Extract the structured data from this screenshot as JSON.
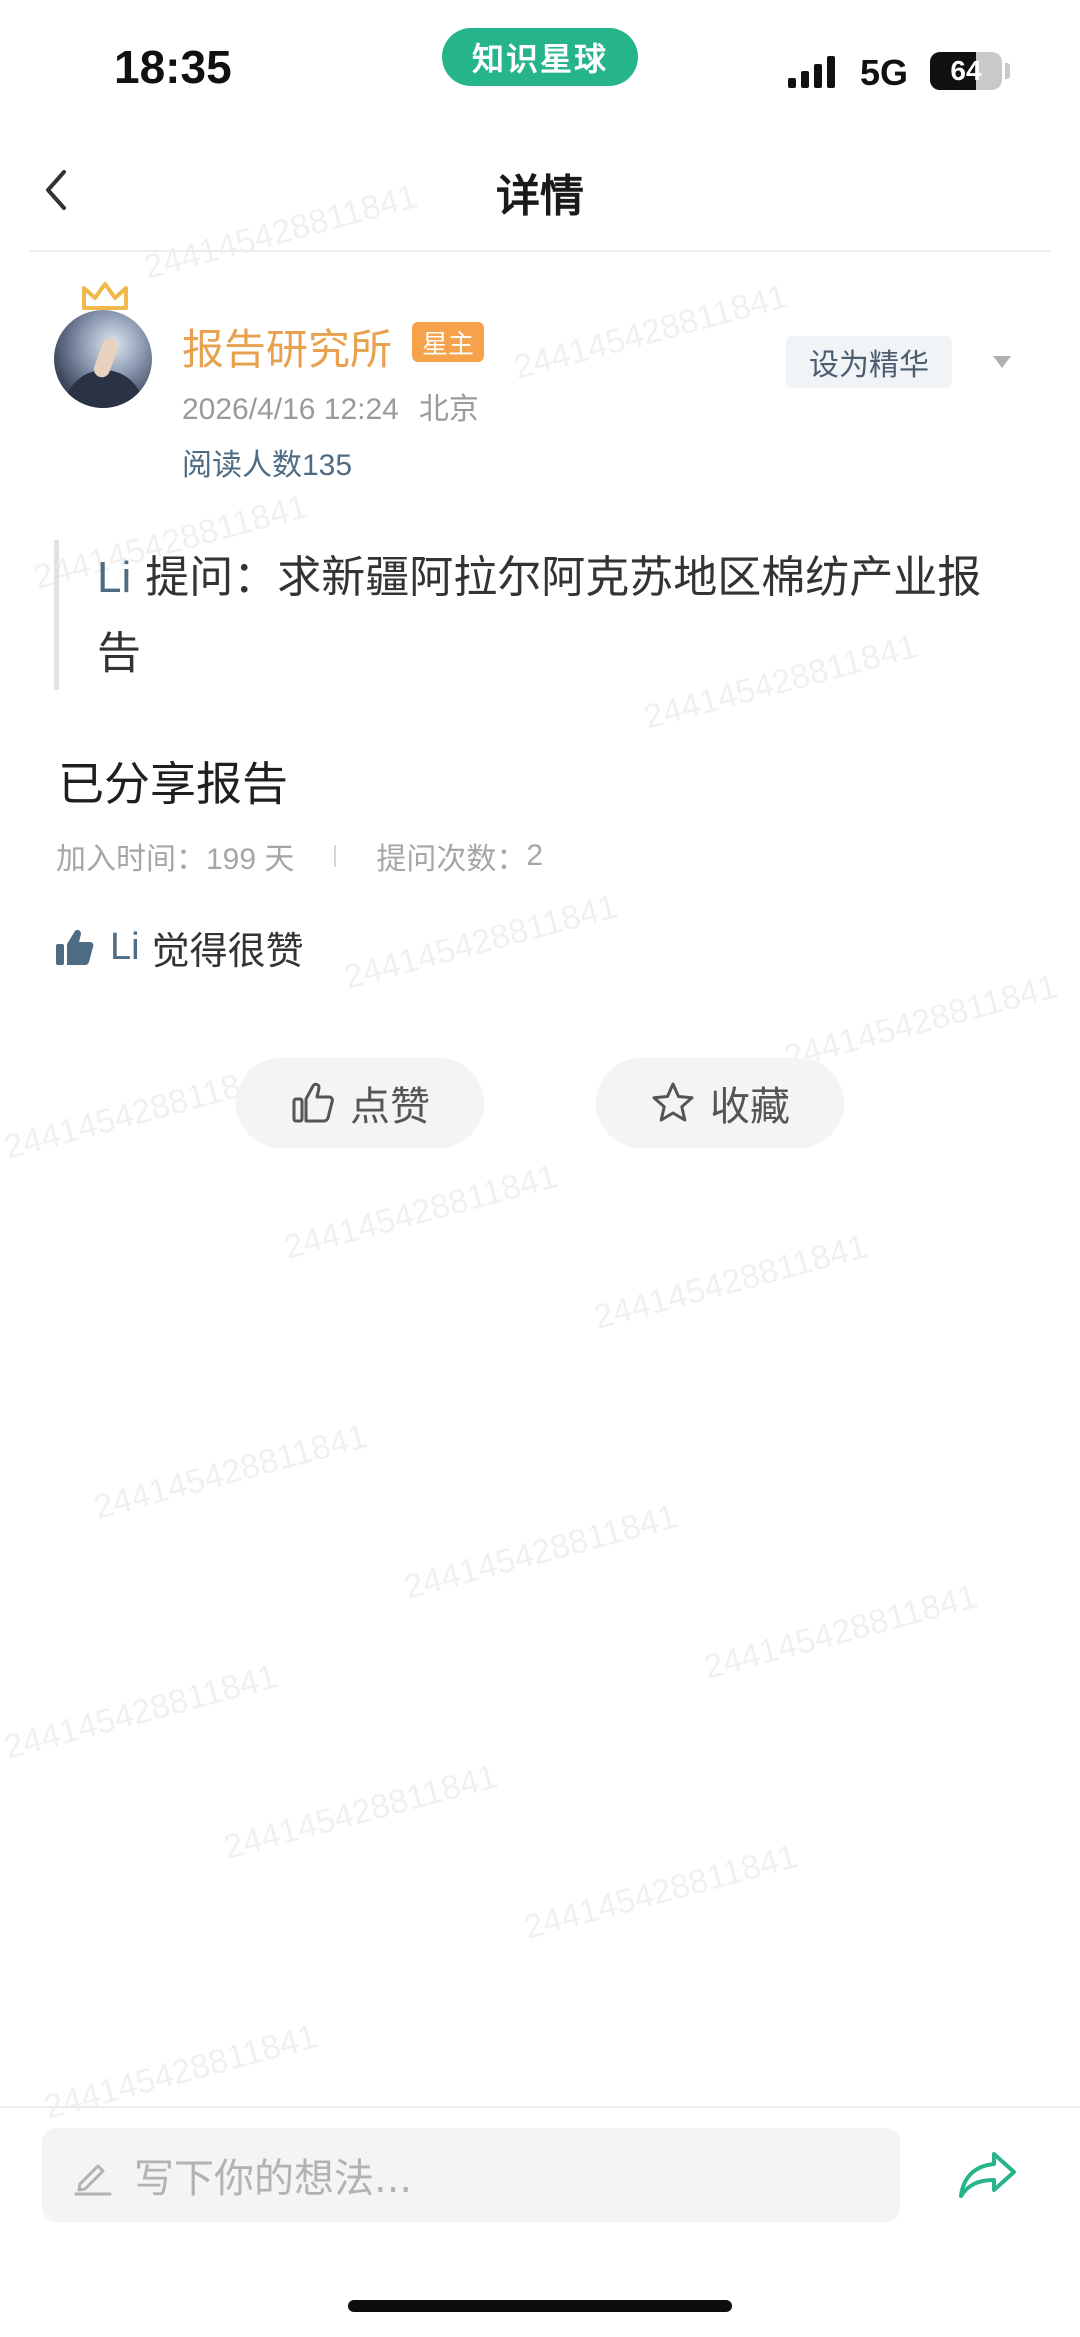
{
  "status_bar": {
    "time": "18:35",
    "app_badge": "知识星球",
    "network": "5G",
    "battery": "64",
    "battery_level": 0.64
  },
  "header": {
    "title": "详情"
  },
  "post": {
    "author": "报告研究所",
    "author_badge": "星主",
    "date": "2026/4/16 12:24",
    "location": "北京",
    "reads_label": "阅读人数",
    "reads_count": "135",
    "essence_button": "设为精华",
    "question_user": "Li",
    "question_text": " 提问：求新疆阿拉尔阿克苏地区棉纺产业报告",
    "answer": "已分享报告",
    "join_label": "加入时间：",
    "join_value": "199 天",
    "ask_label": "提问次数：",
    "ask_value": "2",
    "liker": "Li",
    "liked_text": "觉得很赞"
  },
  "actions": {
    "like": "点赞",
    "favorite": "收藏"
  },
  "comment": {
    "placeholder": "写下你的想法..."
  },
  "watermark": "244145428811841",
  "colors": {
    "accent_green": "#26b58a",
    "author_orange": "#e8a24f",
    "badge_orange": "#f5a24b",
    "link_blue": "#4e6b84"
  }
}
